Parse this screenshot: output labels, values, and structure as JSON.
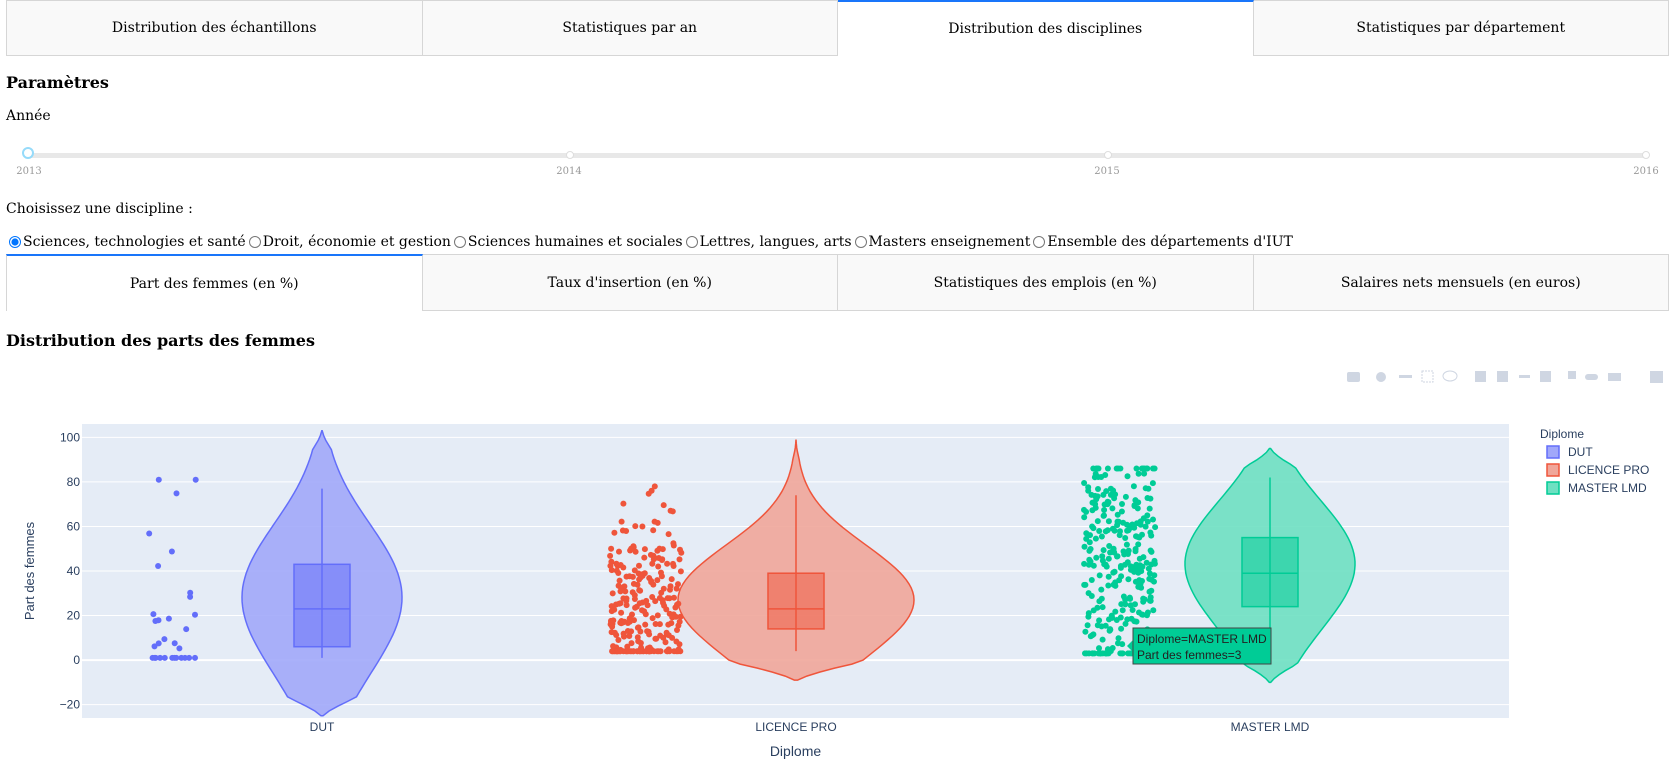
{
  "top_tabs": [
    {
      "label": "Distribution des échantillons"
    },
    {
      "label": "Statistiques par an"
    },
    {
      "label": "Distribution des disciplines"
    },
    {
      "label": "Statistiques par département"
    }
  ],
  "params": {
    "heading": "Paramètres",
    "year_label": "Année",
    "year_marks": [
      "2013",
      "2014",
      "2015",
      "2016"
    ],
    "year_selected": "2013",
    "discipline_label": "Choisissez une discipline :",
    "disciplines": [
      {
        "label": "Sciences, technologies et santé",
        "checked": true
      },
      {
        "label": "Droit, économie et gestion",
        "checked": false
      },
      {
        "label": "Sciences humaines et sociales",
        "checked": false
      },
      {
        "label": "Lettres, langues, arts",
        "checked": false
      },
      {
        "label": "Masters enseignement",
        "checked": false
      },
      {
        "label": "Ensemble des départements d'IUT",
        "checked": false
      }
    ]
  },
  "sub_tabs": [
    {
      "label": "Part des femmes (en %)"
    },
    {
      "label": "Taux d'insertion (en %)"
    },
    {
      "label": "Statistiques des emplois (en %)"
    },
    {
      "label": "Salaires nets mensuels (en euros)"
    }
  ],
  "chart_heading": "Distribution des parts des femmes",
  "chart_data": {
    "type": "violin",
    "title": "",
    "xlabel": "Diplome",
    "ylabel": "Part des femmes",
    "categories": [
      "DUT",
      "LICENCE PRO",
      "MASTER LMD"
    ],
    "yticks": [
      "−20",
      "0",
      "20",
      "40",
      "60",
      "80",
      "100"
    ],
    "ylim": [
      -26,
      106
    ],
    "grid": true,
    "legend": {
      "title": "Diplome",
      "placement": "top-right"
    },
    "series": [
      {
        "name": "DUT",
        "color": "#636efa",
        "fill": "#a1a8fa",
        "q1": 6,
        "median": 23,
        "q3": 43,
        "whisker_low": 1,
        "whisker_high": 77,
        "kde_low": -25,
        "kde_high": 103,
        "points": 31
      },
      {
        "name": "LICENCE PRO",
        "color": "#ef553b",
        "fill": "#f0a69a",
        "q1": 14,
        "median": 23,
        "q3": 39,
        "whisker_low": 4,
        "whisker_high": 74,
        "kde_low": -9,
        "kde_high": 99,
        "points": 250
      },
      {
        "name": "MASTER LMD",
        "color": "#00cc96",
        "fill": "#6ee0c2",
        "q1": 24,
        "median": 39,
        "q3": 55,
        "whisker_low": 3,
        "whisker_high": 82,
        "kde_low": -10,
        "kde_high": 95,
        "points": 300
      }
    ],
    "tooltip": {
      "line1": "Diplome=MASTER LMD",
      "line2": "Part des femmes=3"
    }
  }
}
